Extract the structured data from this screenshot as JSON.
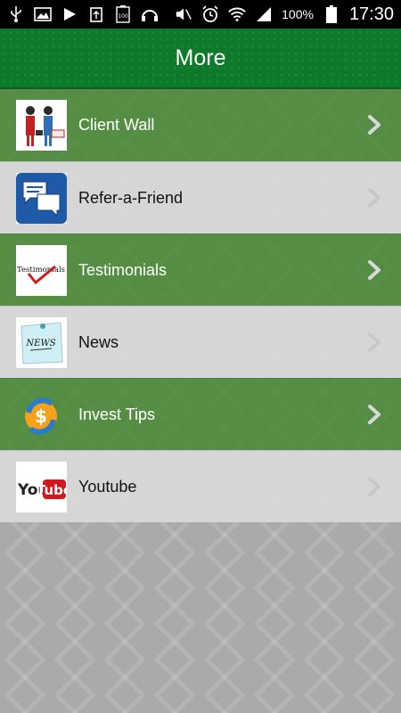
{
  "status_bar": {
    "battery_percent": "100%",
    "time": "17:30",
    "battery_badge": "100"
  },
  "header": {
    "title": "More"
  },
  "menu": {
    "items": [
      {
        "label": "Client Wall",
        "icon": "client-wall-thumbnail"
      },
      {
        "label": "Refer-a-Friend",
        "icon": "speech-bubbles-thumbnail"
      },
      {
        "label": "Testimonials",
        "icon": "testimonials-thumbnail",
        "thumb_text": "Testimonials"
      },
      {
        "label": "News",
        "icon": "news-note-thumbnail",
        "thumb_text": "NEWS"
      },
      {
        "label": "Invest Tips",
        "icon": "invest-dollar-thumbnail"
      },
      {
        "label": "Youtube",
        "icon": "youtube-logo-thumbnail",
        "thumb_text": "YouTube"
      }
    ]
  },
  "colors": {
    "header_green": "#0d7a2a",
    "row_green": "#488834",
    "row_gray": "#dadada",
    "chevron": "#d9d9d9"
  }
}
